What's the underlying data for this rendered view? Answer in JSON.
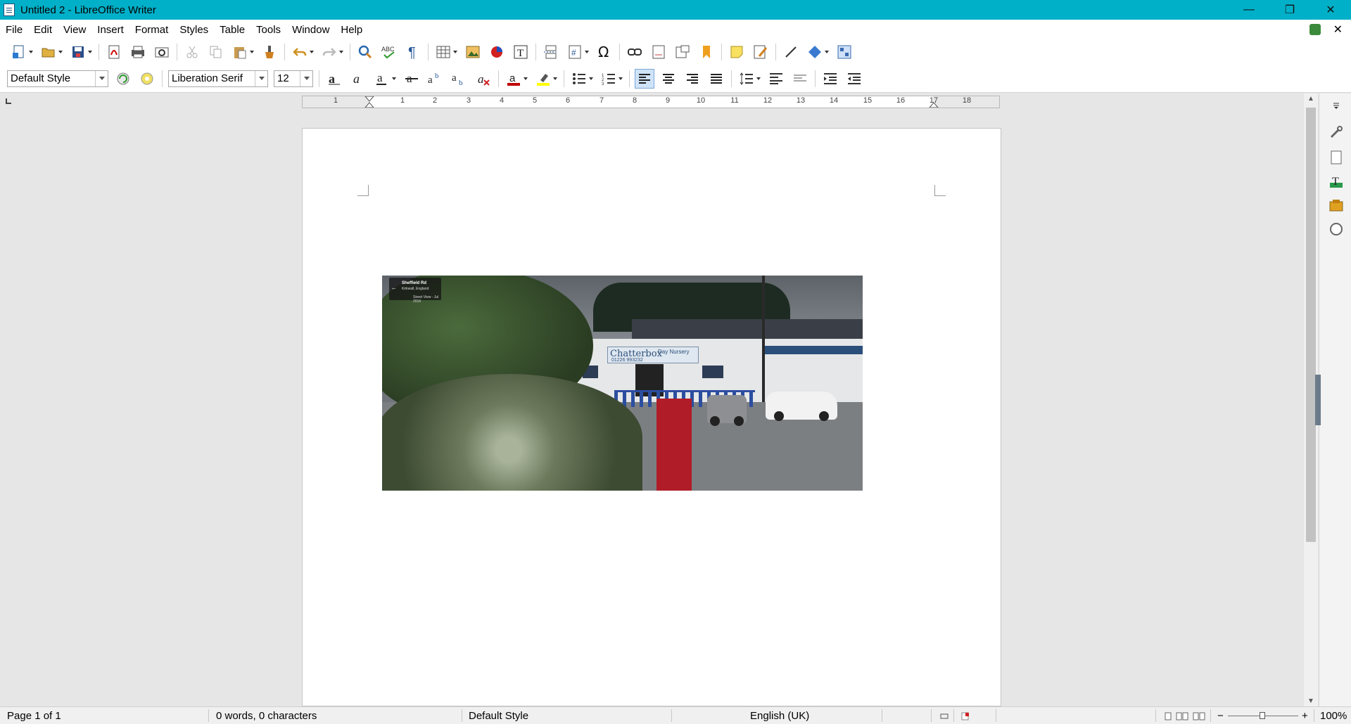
{
  "window": {
    "title": "Untitled 2 - LibreOffice Writer",
    "minimize": "—",
    "restore": "❐",
    "close": "✕"
  },
  "menu": [
    "File",
    "Edit",
    "View",
    "Insert",
    "Format",
    "Styles",
    "Table",
    "Tools",
    "Window",
    "Help"
  ],
  "doc_close": "✕",
  "formatting": {
    "paragraph_style": "Default Style",
    "font_name": "Liberation Serif",
    "font_size": "12"
  },
  "ruler": {
    "numbers": [
      "1",
      "1",
      "2",
      "3",
      "4",
      "5",
      "6",
      "7",
      "8",
      "9",
      "10",
      "11",
      "12",
      "13",
      "14",
      "15",
      "16",
      "17",
      "18"
    ]
  },
  "image": {
    "street_name": "Sheffield Rd",
    "location": "Kirkwall, England",
    "street_view": "Street View - Jul 2016",
    "sign_main": "Chatterbox",
    "sign_secondary": "Day Nursery",
    "sign_phone": "01226 993232"
  },
  "status": {
    "page": "Page 1 of 1",
    "words": "0 words, 0 characters",
    "page_style": "Default Style",
    "language": "English (UK)",
    "zoom_minus": "−",
    "zoom_plus": "+",
    "zoom": "100%"
  },
  "colors": {
    "titlebar": "#00b0c8",
    "font_color": "#c00000",
    "highlight": "#ffff00"
  }
}
